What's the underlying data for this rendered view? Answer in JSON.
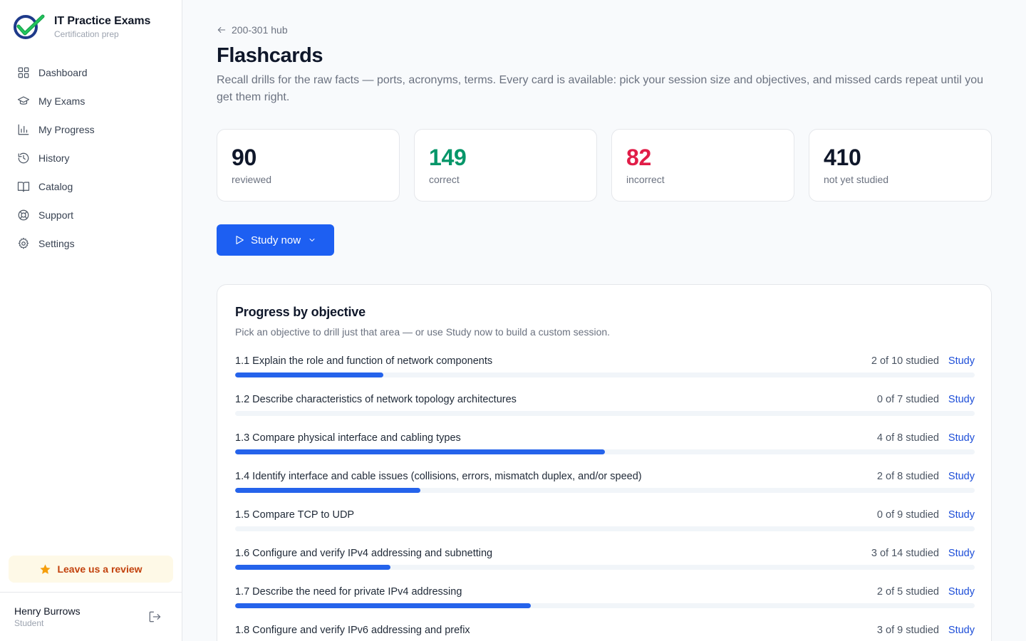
{
  "brand": {
    "title": "IT Practice Exams",
    "subtitle": "Certification prep"
  },
  "sidebar": {
    "items": [
      {
        "label": "Dashboard",
        "icon": "grid-icon"
      },
      {
        "label": "My Exams",
        "icon": "graduation-cap-icon"
      },
      {
        "label": "My Progress",
        "icon": "bar-chart-icon"
      },
      {
        "label": "History",
        "icon": "history-icon"
      },
      {
        "label": "Catalog",
        "icon": "book-open-icon"
      },
      {
        "label": "Support",
        "icon": "life-buoy-icon"
      },
      {
        "label": "Settings",
        "icon": "gear-icon"
      }
    ],
    "review_label": "Leave us a review",
    "user": {
      "name": "Henry Burrows",
      "role": "Student"
    }
  },
  "main": {
    "back_label": "200-301 hub",
    "title": "Flashcards",
    "description": "Recall drills for the raw facts — ports, acronyms, terms. Every card is available: pick your session size and objectives, and missed cards repeat until you get them right.",
    "stats": [
      {
        "value": "90",
        "label": "reviewed",
        "color": "#0f172a"
      },
      {
        "value": "149",
        "label": "correct",
        "color": "#059669"
      },
      {
        "value": "82",
        "label": "incorrect",
        "color": "#e11d48"
      },
      {
        "value": "410",
        "label": "not yet studied",
        "color": "#0f172a"
      }
    ],
    "study_button": "Study now",
    "progress": {
      "title": "Progress by objective",
      "subtitle": "Pick an objective to drill just that area — or use Study now to build a custom session.",
      "study_label": "Study",
      "objectives": [
        {
          "label": "1.1 Explain the role and function of network components",
          "count": "2 of 10 studied",
          "progress": 0.2
        },
        {
          "label": "1.2 Describe characteristics of network topology architectures",
          "count": "0 of 7 studied",
          "progress": 0
        },
        {
          "label": "1.3 Compare physical interface and cabling types",
          "count": "4 of 8 studied",
          "progress": 0.5
        },
        {
          "label": "1.4 Identify interface and cable issues (collisions, errors, mismatch duplex, and/or speed)",
          "count": "2 of 8 studied",
          "progress": 0.25
        },
        {
          "label": "1.5 Compare TCP to UDP",
          "count": "0 of 9 studied",
          "progress": 0
        },
        {
          "label": "1.6 Configure and verify IPv4 addressing and subnetting",
          "count": "3 of 14 studied",
          "progress": 0.21
        },
        {
          "label": "1.7 Describe the need for private IPv4 addressing",
          "count": "2 of 5 studied",
          "progress": 0.4
        },
        {
          "label": "1.8 Configure and verify IPv6 addressing and prefix",
          "count": "3 of 9 studied",
          "progress": 0.33
        }
      ]
    }
  }
}
